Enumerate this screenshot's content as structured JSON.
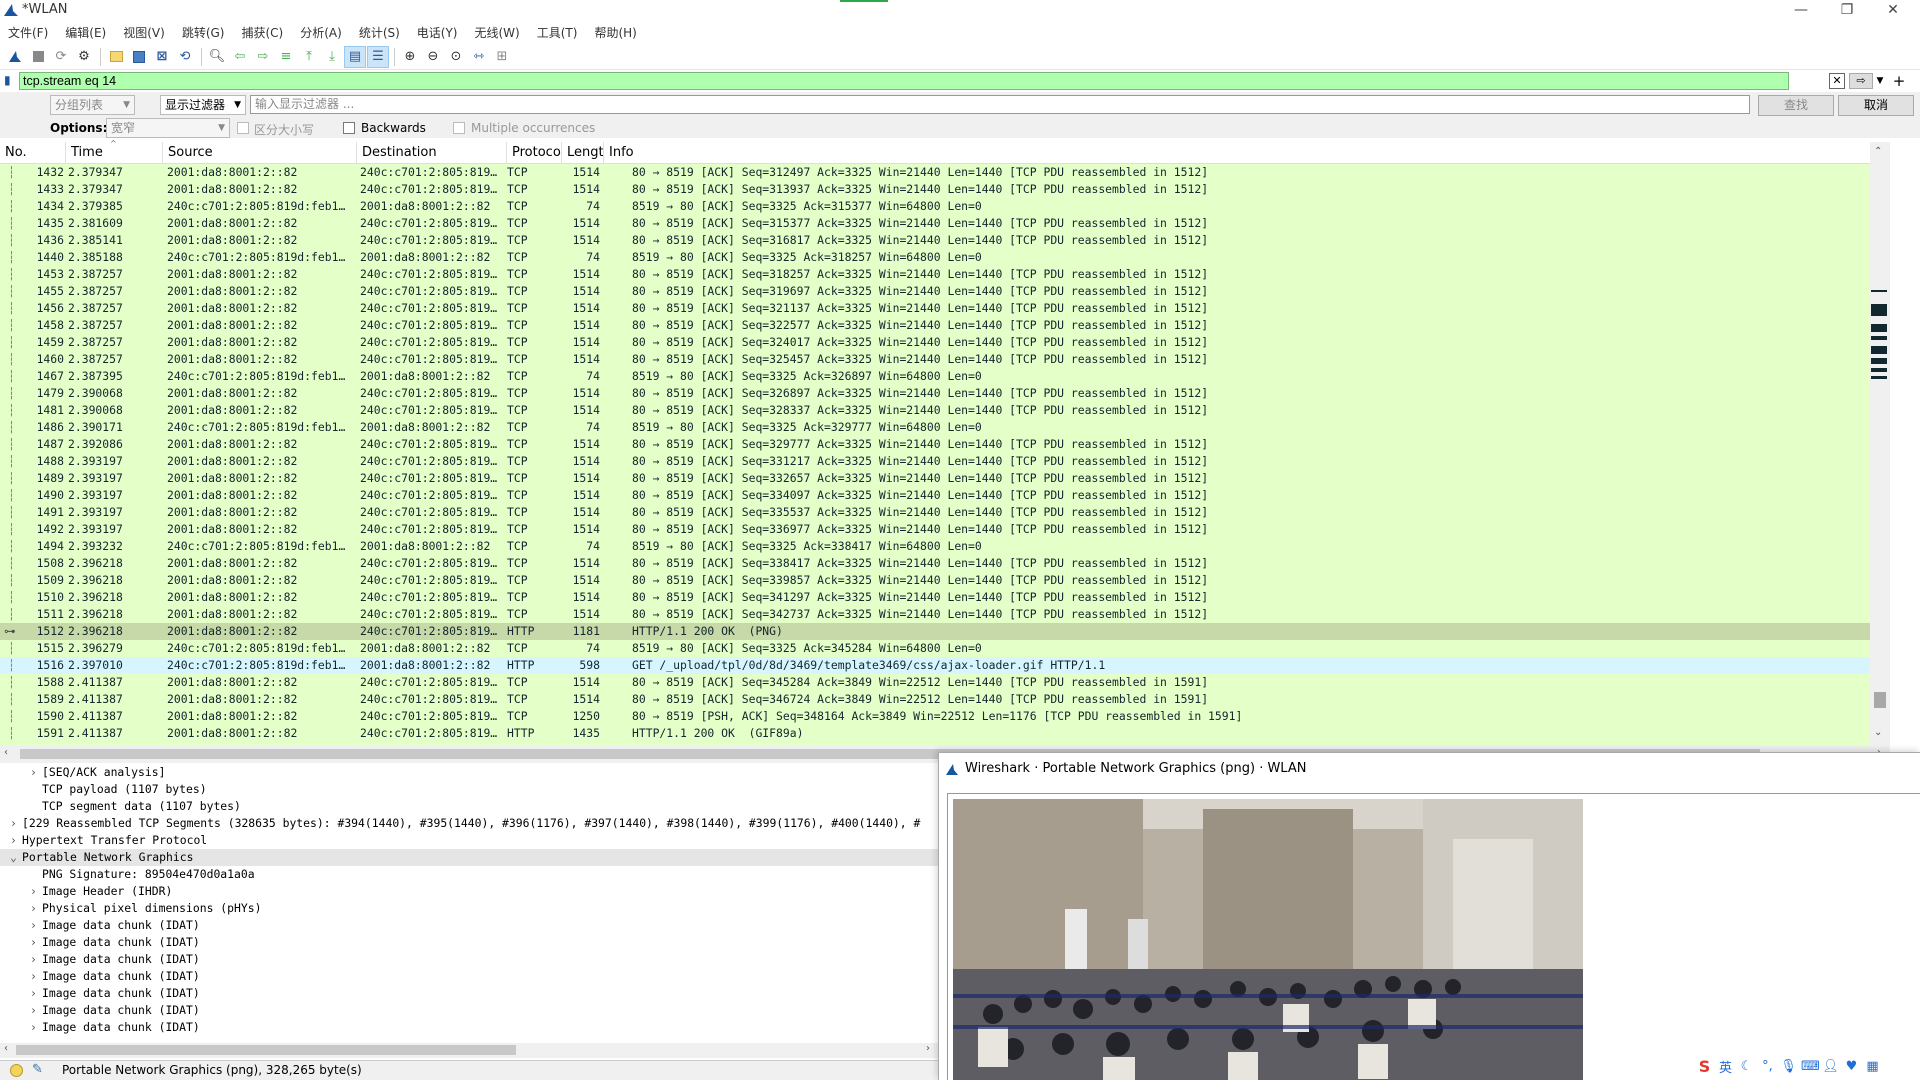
{
  "window": {
    "title": "*WLAN"
  },
  "menu": [
    "文件(F)",
    "编辑(E)",
    "视图(V)",
    "跳转(G)",
    "捕获(C)",
    "分析(A)",
    "统计(S)",
    "电话(Y)",
    "无线(W)",
    "工具(T)",
    "帮助(H)"
  ],
  "filter": {
    "value": "tcp.stream eq 14"
  },
  "find": {
    "scope": "分组列表",
    "type": "显示过滤器",
    "placeholder": "输入显示过滤器 ...",
    "find_btn": "查找",
    "cancel_btn": "取消",
    "options_label": "Options:",
    "charset": "宽窄",
    "case_label": "区分大小写",
    "backwards_label": "Backwards",
    "multi_label": "Multiple occurrences"
  },
  "columns": [
    "No.",
    "Time",
    "Source",
    "Destination",
    "Protoco",
    "Lengt",
    "Info"
  ],
  "packets": [
    {
      "no": "1432",
      "time": "2.379347",
      "src": "2001:da8:8001:2::82",
      "dst": "240c:c701:2:805:819…",
      "proto": "TCP",
      "len": "1514",
      "info": "80 → 8519 [ACK] Seq=312497 Ack=3325 Win=21440 Len=1440 [TCP PDU reassembled in 1512]"
    },
    {
      "no": "1433",
      "time": "2.379347",
      "src": "2001:da8:8001:2::82",
      "dst": "240c:c701:2:805:819…",
      "proto": "TCP",
      "len": "1514",
      "info": "80 → 8519 [ACK] Seq=313937 Ack=3325 Win=21440 Len=1440 [TCP PDU reassembled in 1512]"
    },
    {
      "no": "1434",
      "time": "2.379385",
      "src": "240c:c701:2:805:819d:feb1…",
      "dst": "2001:da8:8001:2::82",
      "proto": "TCP",
      "len": "74",
      "info": "8519 → 80 [ACK] Seq=3325 Ack=315377 Win=64800 Len=0"
    },
    {
      "no": "1435",
      "time": "2.381609",
      "src": "2001:da8:8001:2::82",
      "dst": "240c:c701:2:805:819…",
      "proto": "TCP",
      "len": "1514",
      "info": "80 → 8519 [ACK] Seq=315377 Ack=3325 Win=21440 Len=1440 [TCP PDU reassembled in 1512]"
    },
    {
      "no": "1436",
      "time": "2.385141",
      "src": "2001:da8:8001:2::82",
      "dst": "240c:c701:2:805:819…",
      "proto": "TCP",
      "len": "1514",
      "info": "80 → 8519 [ACK] Seq=316817 Ack=3325 Win=21440 Len=1440 [TCP PDU reassembled in 1512]"
    },
    {
      "no": "1440",
      "time": "2.385188",
      "src": "240c:c701:2:805:819d:feb1…",
      "dst": "2001:da8:8001:2::82",
      "proto": "TCP",
      "len": "74",
      "info": "8519 → 80 [ACK] Seq=3325 Ack=318257 Win=64800 Len=0"
    },
    {
      "no": "1453",
      "time": "2.387257",
      "src": "2001:da8:8001:2::82",
      "dst": "240c:c701:2:805:819…",
      "proto": "TCP",
      "len": "1514",
      "info": "80 → 8519 [ACK] Seq=318257 Ack=3325 Win=21440 Len=1440 [TCP PDU reassembled in 1512]"
    },
    {
      "no": "1455",
      "time": "2.387257",
      "src": "2001:da8:8001:2::82",
      "dst": "240c:c701:2:805:819…",
      "proto": "TCP",
      "len": "1514",
      "info": "80 → 8519 [ACK] Seq=319697 Ack=3325 Win=21440 Len=1440 [TCP PDU reassembled in 1512]"
    },
    {
      "no": "1456",
      "time": "2.387257",
      "src": "2001:da8:8001:2::82",
      "dst": "240c:c701:2:805:819…",
      "proto": "TCP",
      "len": "1514",
      "info": "80 → 8519 [ACK] Seq=321137 Ack=3325 Win=21440 Len=1440 [TCP PDU reassembled in 1512]"
    },
    {
      "no": "1458",
      "time": "2.387257",
      "src": "2001:da8:8001:2::82",
      "dst": "240c:c701:2:805:819…",
      "proto": "TCP",
      "len": "1514",
      "info": "80 → 8519 [ACK] Seq=322577 Ack=3325 Win=21440 Len=1440 [TCP PDU reassembled in 1512]"
    },
    {
      "no": "1459",
      "time": "2.387257",
      "src": "2001:da8:8001:2::82",
      "dst": "240c:c701:2:805:819…",
      "proto": "TCP",
      "len": "1514",
      "info": "80 → 8519 [ACK] Seq=324017 Ack=3325 Win=21440 Len=1440 [TCP PDU reassembled in 1512]"
    },
    {
      "no": "1460",
      "time": "2.387257",
      "src": "2001:da8:8001:2::82",
      "dst": "240c:c701:2:805:819…",
      "proto": "TCP",
      "len": "1514",
      "info": "80 → 8519 [ACK] Seq=325457 Ack=3325 Win=21440 Len=1440 [TCP PDU reassembled in 1512]"
    },
    {
      "no": "1467",
      "time": "2.387395",
      "src": "240c:c701:2:805:819d:feb1…",
      "dst": "2001:da8:8001:2::82",
      "proto": "TCP",
      "len": "74",
      "info": "8519 → 80 [ACK] Seq=3325 Ack=326897 Win=64800 Len=0"
    },
    {
      "no": "1479",
      "time": "2.390068",
      "src": "2001:da8:8001:2::82",
      "dst": "240c:c701:2:805:819…",
      "proto": "TCP",
      "len": "1514",
      "info": "80 → 8519 [ACK] Seq=326897 Ack=3325 Win=21440 Len=1440 [TCP PDU reassembled in 1512]"
    },
    {
      "no": "1481",
      "time": "2.390068",
      "src": "2001:da8:8001:2::82",
      "dst": "240c:c701:2:805:819…",
      "proto": "TCP",
      "len": "1514",
      "info": "80 → 8519 [ACK] Seq=328337 Ack=3325 Win=21440 Len=1440 [TCP PDU reassembled in 1512]"
    },
    {
      "no": "1486",
      "time": "2.390171",
      "src": "240c:c701:2:805:819d:feb1…",
      "dst": "2001:da8:8001:2::82",
      "proto": "TCP",
      "len": "74",
      "info": "8519 → 80 [ACK] Seq=3325 Ack=329777 Win=64800 Len=0"
    },
    {
      "no": "1487",
      "time": "2.392086",
      "src": "2001:da8:8001:2::82",
      "dst": "240c:c701:2:805:819…",
      "proto": "TCP",
      "len": "1514",
      "info": "80 → 8519 [ACK] Seq=329777 Ack=3325 Win=21440 Len=1440 [TCP PDU reassembled in 1512]"
    },
    {
      "no": "1488",
      "time": "2.393197",
      "src": "2001:da8:8001:2::82",
      "dst": "240c:c701:2:805:819…",
      "proto": "TCP",
      "len": "1514",
      "info": "80 → 8519 [ACK] Seq=331217 Ack=3325 Win=21440 Len=1440 [TCP PDU reassembled in 1512]"
    },
    {
      "no": "1489",
      "time": "2.393197",
      "src": "2001:da8:8001:2::82",
      "dst": "240c:c701:2:805:819…",
      "proto": "TCP",
      "len": "1514",
      "info": "80 → 8519 [ACK] Seq=332657 Ack=3325 Win=21440 Len=1440 [TCP PDU reassembled in 1512]"
    },
    {
      "no": "1490",
      "time": "2.393197",
      "src": "2001:da8:8001:2::82",
      "dst": "240c:c701:2:805:819…",
      "proto": "TCP",
      "len": "1514",
      "info": "80 → 8519 [ACK] Seq=334097 Ack=3325 Win=21440 Len=1440 [TCP PDU reassembled in 1512]"
    },
    {
      "no": "1491",
      "time": "2.393197",
      "src": "2001:da8:8001:2::82",
      "dst": "240c:c701:2:805:819…",
      "proto": "TCP",
      "len": "1514",
      "info": "80 → 8519 [ACK] Seq=335537 Ack=3325 Win=21440 Len=1440 [TCP PDU reassembled in 1512]"
    },
    {
      "no": "1492",
      "time": "2.393197",
      "src": "2001:da8:8001:2::82",
      "dst": "240c:c701:2:805:819…",
      "proto": "TCP",
      "len": "1514",
      "info": "80 → 8519 [ACK] Seq=336977 Ack=3325 Win=21440 Len=1440 [TCP PDU reassembled in 1512]"
    },
    {
      "no": "1494",
      "time": "2.393232",
      "src": "240c:c701:2:805:819d:feb1…",
      "dst": "2001:da8:8001:2::82",
      "proto": "TCP",
      "len": "74",
      "info": "8519 → 80 [ACK] Seq=3325 Ack=338417 Win=64800 Len=0"
    },
    {
      "no": "1508",
      "time": "2.396218",
      "src": "2001:da8:8001:2::82",
      "dst": "240c:c701:2:805:819…",
      "proto": "TCP",
      "len": "1514",
      "info": "80 → 8519 [ACK] Seq=338417 Ack=3325 Win=21440 Len=1440 [TCP PDU reassembled in 1512]"
    },
    {
      "no": "1509",
      "time": "2.396218",
      "src": "2001:da8:8001:2::82",
      "dst": "240c:c701:2:805:819…",
      "proto": "TCP",
      "len": "1514",
      "info": "80 → 8519 [ACK] Seq=339857 Ack=3325 Win=21440 Len=1440 [TCP PDU reassembled in 1512]"
    },
    {
      "no": "1510",
      "time": "2.396218",
      "src": "2001:da8:8001:2::82",
      "dst": "240c:c701:2:805:819…",
      "proto": "TCP",
      "len": "1514",
      "info": "80 → 8519 [ACK] Seq=341297 Ack=3325 Win=21440 Len=1440 [TCP PDU reassembled in 1512]"
    },
    {
      "no": "1511",
      "time": "2.396218",
      "src": "2001:da8:8001:2::82",
      "dst": "240c:c701:2:805:819…",
      "proto": "TCP",
      "len": "1514",
      "info": "80 → 8519 [ACK] Seq=342737 Ack=3325 Win=21440 Len=1440 [TCP PDU reassembled in 1512]"
    },
    {
      "no": "1512",
      "time": "2.396218",
      "src": "2001:da8:8001:2::82",
      "dst": "240c:c701:2:805:819…",
      "proto": "HTTP",
      "len": "1181",
      "info": "HTTP/1.1 200 OK  (PNG)",
      "state": "sel"
    },
    {
      "no": "1515",
      "time": "2.396279",
      "src": "240c:c701:2:805:819d:feb1…",
      "dst": "2001:da8:8001:2::82",
      "proto": "TCP",
      "len": "74",
      "info": "8519 → 80 [ACK] Seq=3325 Ack=345284 Win=64800 Len=0"
    },
    {
      "no": "1516",
      "time": "2.397010",
      "src": "240c:c701:2:805:819d:feb1…",
      "dst": "2001:da8:8001:2::82",
      "proto": "HTTP",
      "len": "598",
      "info": "GET /_upload/tpl/0d/8d/3469/template3469/css/ajax-loader.gif HTTP/1.1",
      "state": "alt"
    },
    {
      "no": "1588",
      "time": "2.411387",
      "src": "2001:da8:8001:2::82",
      "dst": "240c:c701:2:805:819…",
      "proto": "TCP",
      "len": "1514",
      "info": "80 → 8519 [ACK] Seq=345284 Ack=3849 Win=22512 Len=1440 [TCP PDU reassembled in 1591]"
    },
    {
      "no": "1589",
      "time": "2.411387",
      "src": "2001:da8:8001:2::82",
      "dst": "240c:c701:2:805:819…",
      "proto": "TCP",
      "len": "1514",
      "info": "80 → 8519 [ACK] Seq=346724 Ack=3849 Win=22512 Len=1440 [TCP PDU reassembled in 1591]"
    },
    {
      "no": "1590",
      "time": "2.411387",
      "src": "2001:da8:8001:2::82",
      "dst": "240c:c701:2:805:819…",
      "proto": "TCP",
      "len": "1250",
      "info": "80 → 8519 [PSH, ACK] Seq=348164 Ack=3849 Win=22512 Len=1176 [TCP PDU reassembled in 1591]"
    },
    {
      "no": "1591",
      "time": "2.411387",
      "src": "2001:da8:8001:2::82",
      "dst": "240c:c701:2:805:819…",
      "proto": "HTTP",
      "len": "1435",
      "info": "HTTP/1.1 200 OK  (GIF89a)"
    }
  ],
  "details": [
    {
      "indent": 2,
      "exp": ">",
      "text": "[SEQ/ACK analysis]"
    },
    {
      "indent": 2,
      "exp": "",
      "text": "TCP payload (1107 bytes)"
    },
    {
      "indent": 2,
      "exp": "",
      "text": "TCP segment data (1107 bytes)"
    },
    {
      "indent": 0,
      "exp": ">",
      "text": "[229 Reassembled TCP Segments (328635 bytes): #394(1440), #395(1440), #396(1176), #397(1440), #398(1440), #399(1176), #400(1440), #"
    },
    {
      "indent": 0,
      "exp": ">",
      "text": "Hypertext Transfer Protocol"
    },
    {
      "indent": 0,
      "exp": "v",
      "text": "Portable Network Graphics",
      "sel": true
    },
    {
      "indent": 2,
      "exp": "",
      "text": "PNG Signature: 89504e470d0a1a0a"
    },
    {
      "indent": 2,
      "exp": ">",
      "text": "Image Header (IHDR)"
    },
    {
      "indent": 2,
      "exp": ">",
      "text": "Physical pixel dimensions (pHYs)"
    },
    {
      "indent": 2,
      "exp": ">",
      "text": "Image data chunk (IDAT)"
    },
    {
      "indent": 2,
      "exp": ">",
      "text": "Image data chunk (IDAT)"
    },
    {
      "indent": 2,
      "exp": ">",
      "text": "Image data chunk (IDAT)"
    },
    {
      "indent": 2,
      "exp": ">",
      "text": "Image data chunk (IDAT)"
    },
    {
      "indent": 2,
      "exp": ">",
      "text": "Image data chunk (IDAT)"
    },
    {
      "indent": 2,
      "exp": ">",
      "text": "Image data chunk (IDAT)"
    },
    {
      "indent": 2,
      "exp": ">",
      "text": "Image data chunk (IDAT)"
    }
  ],
  "status": {
    "text": "Portable Network Graphics (png), 328,265 byte(s)"
  },
  "popup": {
    "title": "Wireshark · Portable Network Graphics (png) · WLAN"
  },
  "ime": {
    "mode": "英"
  },
  "colors": {
    "filter_valid": "#afffaf",
    "tcp_row": "#e4ffc7",
    "selected_row": "#c7d9a8",
    "http_request_row": "#d7f5ff",
    "accent": "#1a55a0"
  }
}
